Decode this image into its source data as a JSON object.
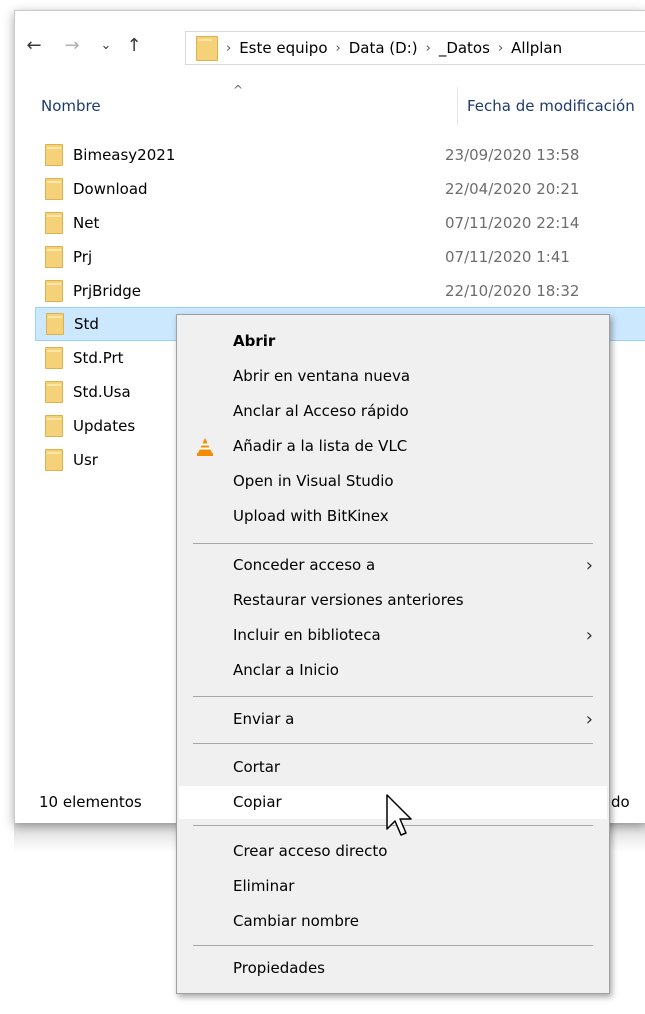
{
  "nav": {
    "back_icon": "←",
    "forward_icon": "→",
    "recent_icon": "⌄",
    "up_icon": "↑"
  },
  "breadcrumb": [
    "Este equipo",
    "Data (D:)",
    "_Datos",
    "Allplan"
  ],
  "columns": {
    "name": "Nombre",
    "date": "Fecha de modificación"
  },
  "files": [
    {
      "name": "Bimeasy2021",
      "date": "23/09/2020 13:58"
    },
    {
      "name": "Download",
      "date": "22/04/2020 20:21"
    },
    {
      "name": "Net",
      "date": "07/11/2020 22:14"
    },
    {
      "name": "Prj",
      "date": "07/11/2020 1:41"
    },
    {
      "name": "PrjBridge",
      "date": "22/10/2020 18:32"
    },
    {
      "name": "Std",
      "date": ""
    },
    {
      "name": "Std.Prt",
      "date": ""
    },
    {
      "name": "Std.Usa",
      "date": ""
    },
    {
      "name": "Updates",
      "date": ""
    },
    {
      "name": "Usr",
      "date": ""
    }
  ],
  "status": {
    "count": "10 elementos",
    "tail": "do"
  },
  "context_menu": {
    "open": "Abrir",
    "open_new_window": "Abrir en ventana nueva",
    "pin_quick_access": "Anclar al Acceso rápido",
    "add_vlc": "Añadir a la lista de VLC",
    "open_visual_studio": "Open in Visual Studio",
    "upload_bitkinex": "Upload with BitKinex",
    "give_access": "Conceder acceso a",
    "restore_versions": "Restaurar versiones anteriores",
    "include_library": "Incluir en biblioteca",
    "pin_start": "Anclar a Inicio",
    "send_to": "Enviar a",
    "cut": "Cortar",
    "copy": "Copiar",
    "create_shortcut": "Crear acceso directo",
    "delete": "Eliminar",
    "rename": "Cambiar nombre",
    "properties": "Propiedades",
    "submenu_arrow": "›"
  },
  "colors": {
    "selection": "#cce8ff",
    "selection_border": "#99d1ff",
    "menu_bg": "#f0f0f0",
    "menu_hover": "#ffffff",
    "folder": "#f5d27a",
    "vlc_orange": "#f28c00"
  }
}
